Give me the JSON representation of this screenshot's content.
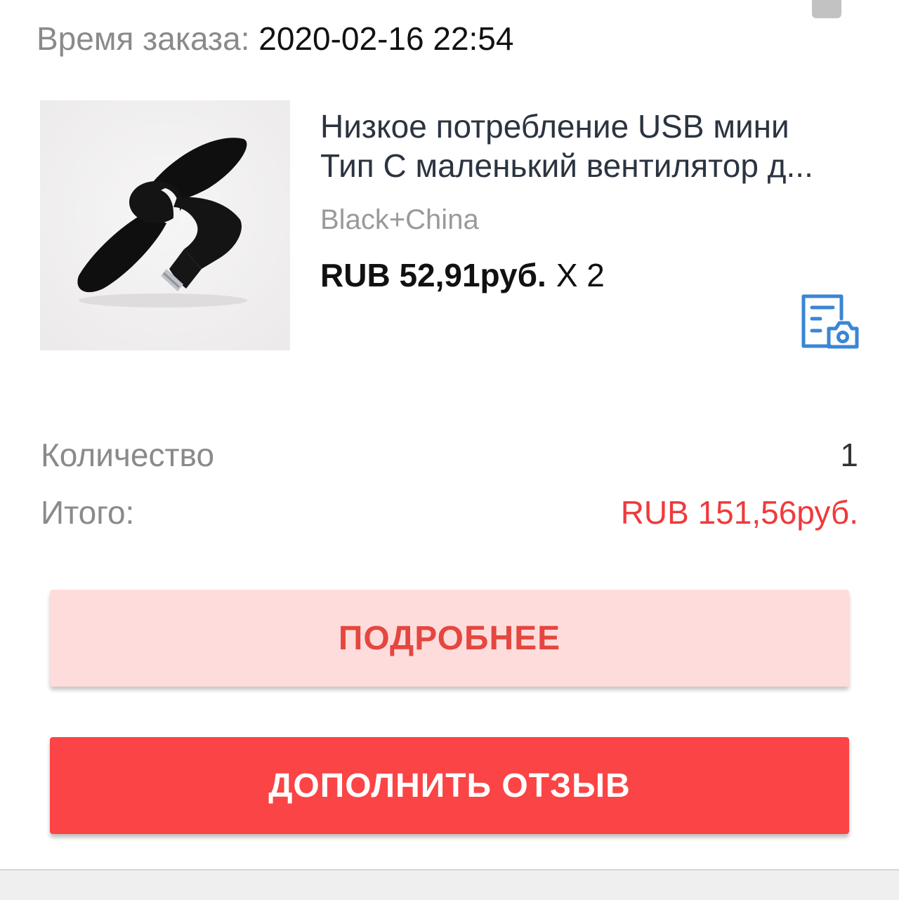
{
  "order": {
    "time_label": "Время заказа:",
    "time_value": "2020-02-16 22:54"
  },
  "product": {
    "image_icon": "usb-c-mini-fan-photo",
    "title_line1": "Низкое потребление USB мини",
    "title_line2": "Тип С маленький вентилятор д...",
    "variant": "Black+China",
    "price": "RUB 52,91руб.",
    "quantity_multiplier": "X 2",
    "review_photo_icon": "document-camera-icon"
  },
  "summary": {
    "quantity_label": "Количество",
    "quantity_value": "1",
    "total_label": "Итого:",
    "total_value": "RUB 151,56руб."
  },
  "buttons": {
    "details_label": "ПОДРОБНЕЕ",
    "add_review_label": "ДОПОЛНИТЬ ОТЗЫВ"
  },
  "colors": {
    "accent_red": "#fb4445",
    "total_red": "#ef3a3c",
    "details_bg": "#ffdcdc",
    "icon_blue": "#3a86d6"
  }
}
